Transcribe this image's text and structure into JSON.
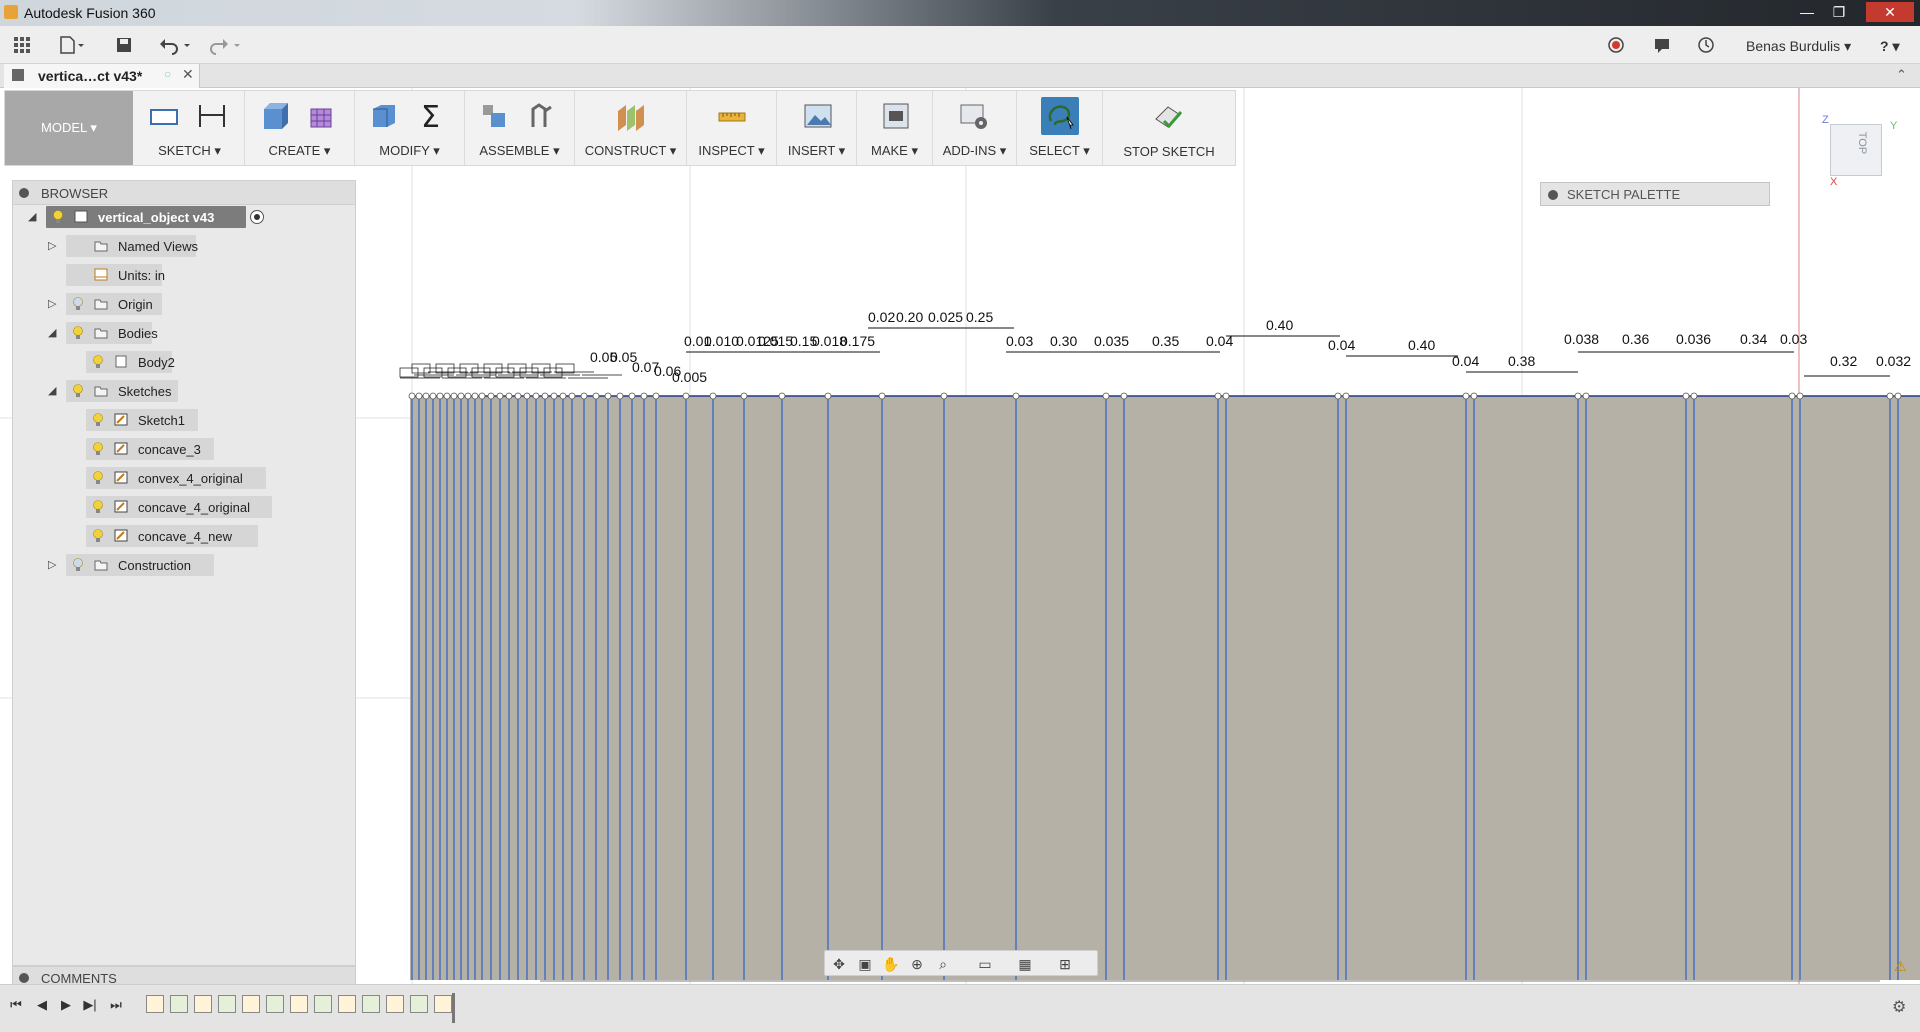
{
  "window": {
    "title": "Autodesk Fusion 360",
    "minimize_label": "—",
    "maximize_label": "❐",
    "close_label": "✕"
  },
  "quick_access": {
    "user_name": "Benas Burdulis",
    "help_label": "?"
  },
  "document_tab": {
    "label": "vertica…ct v43*"
  },
  "toolbar": {
    "mode_label": "MODEL ▾",
    "groups": [
      {
        "label": "SKETCH ▾"
      },
      {
        "label": "CREATE ▾"
      },
      {
        "label": "MODIFY ▾"
      },
      {
        "label": "ASSEMBLE ▾"
      },
      {
        "label": "CONSTRUCT ▾"
      },
      {
        "label": "INSPECT ▾"
      },
      {
        "label": "INSERT ▾"
      },
      {
        "label": "MAKE ▾"
      },
      {
        "label": "ADD-INS ▾"
      },
      {
        "label": "SELECT ▾"
      },
      {
        "label": "STOP SKETCH"
      }
    ]
  },
  "browser": {
    "header": "BROWSER",
    "root": "vertical_object v43",
    "items": [
      {
        "label": "Named Views"
      },
      {
        "label": "Units: in"
      },
      {
        "label": "Origin"
      },
      {
        "label": "Bodies"
      },
      {
        "label": "Body2"
      },
      {
        "label": "Sketches"
      },
      {
        "label": "Sketch1"
      },
      {
        "label": "concave_3"
      },
      {
        "label": "convex_4_original"
      },
      {
        "label": "concave_4_original"
      },
      {
        "label": "concave_4_new"
      },
      {
        "label": "Construction"
      }
    ]
  },
  "comments": {
    "header": "COMMENTS"
  },
  "sketch_palette": {
    "header": "SKETCH PALETTE"
  },
  "viewcube": {
    "face": "TOP",
    "axis_x": "X",
    "axis_y": "Y",
    "axis_z": "Z"
  },
  "dimensions": {
    "top_row": [
      "0.02",
      "0.20",
      "0.025",
      "0.25"
    ],
    "mid_row": [
      "0.01",
      "0.010",
      "0.0125",
      "0.015",
      "0.15",
      "0.018",
      "0.175",
      "0.03",
      "0.30",
      "0.035",
      "0.35",
      "0.04",
      "0.40",
      "0.04",
      "0.40",
      "0.038",
      "0.36",
      "0.036",
      "0.34",
      "0.03"
    ],
    "low_row": [
      "0.04",
      "0.38",
      "0.32",
      "0.032"
    ],
    "cluster_row": [
      "0.005",
      "0.06",
      "0.07",
      "0.05",
      "0.05"
    ]
  },
  "colors": {
    "sketch_fill": "#b6b1a6",
    "sketch_line": "#2f5fc8",
    "dimension_text": "#111111",
    "mode_button": "#a8a8a8",
    "select_highlight": "#3a7fb8"
  }
}
